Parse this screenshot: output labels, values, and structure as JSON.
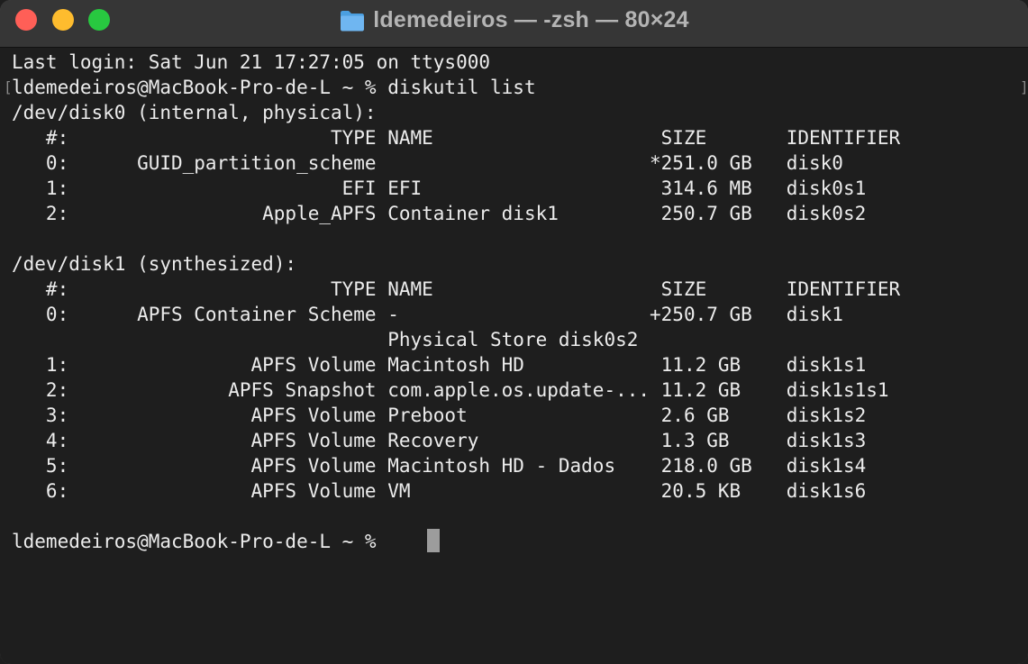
{
  "window": {
    "title": "ldemedeiros — -zsh — 80×24",
    "icon": "folder-icon"
  },
  "terminal": {
    "lines": [
      "Last login: Sat Jun 21 17:27:05 on ttys000",
      "ldemedeiros@MacBook-Pro-de-L ~ % diskutil list",
      "/dev/disk0 (internal, physical):",
      "   #:                       TYPE NAME                    SIZE       IDENTIFIER",
      "   0:      GUID_partition_scheme                        *251.0 GB   disk0",
      "   1:                        EFI EFI                     314.6 MB   disk0s1",
      "   2:                 Apple_APFS Container disk1         250.7 GB   disk0s2",
      "",
      "/dev/disk1 (synthesized):",
      "   #:                       TYPE NAME                    SIZE       IDENTIFIER",
      "   0:      APFS Container Scheme -                      +250.7 GB   disk1",
      "                                 Physical Store disk0s2",
      "   1:                APFS Volume Macintosh HD            11.2 GB    disk1s1",
      "   2:              APFS Snapshot com.apple.os.update-... 11.2 GB    disk1s1s1",
      "   3:                APFS Volume Preboot                 2.6 GB     disk1s2",
      "   4:                APFS Volume Recovery                1.3 GB     disk1s3",
      "   5:                APFS Volume Macintosh HD - Dados    218.0 GB   disk1s4",
      "   6:                APFS Volume VM                      20.5 KB    disk1s6",
      "",
      "ldemedeiros@MacBook-Pro-de-L ~ % "
    ],
    "colors": {
      "background": "#1e1e1e",
      "text": "#ececec",
      "titlebar": "#363636",
      "close": "#ff5f57",
      "minimize": "#febc2e",
      "zoom": "#28c840"
    },
    "bracket_left": "[",
    "bracket_right": "]"
  }
}
